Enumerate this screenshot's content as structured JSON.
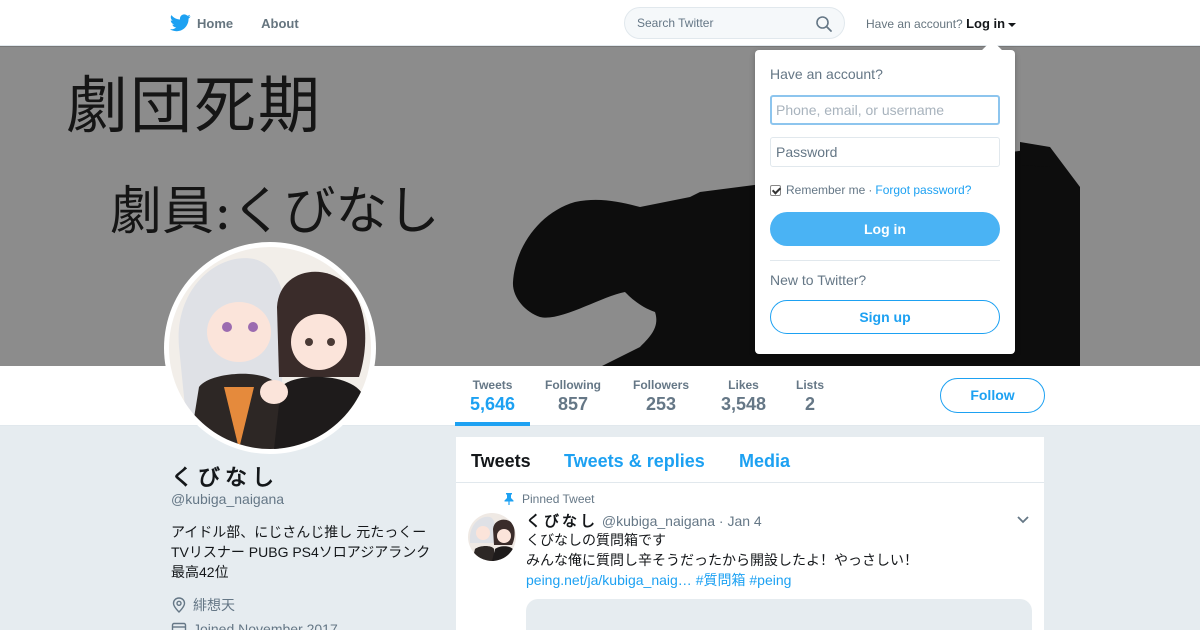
{
  "nav": {
    "home_label": "Home",
    "about_label": "About",
    "search_placeholder": "Search Twitter",
    "have_account": "Have an account?",
    "login_label": "Log in"
  },
  "banner": {
    "title": "劇団死期",
    "subtitle": "劇員:くびなし"
  },
  "stats": [
    {
      "label": "Tweets",
      "value": "5,646"
    },
    {
      "label": "Following",
      "value": "857"
    },
    {
      "label": "Followers",
      "value": "253"
    },
    {
      "label": "Likes",
      "value": "3,548"
    },
    {
      "label": "Lists",
      "value": "2"
    }
  ],
  "follow_label": "Follow",
  "profile": {
    "name": "くびなし",
    "handle": "@kubiga_naigana",
    "bio": "アイドル部、にじさんじ推し 元たっくーTVリスナー PUBG PS4ソロアジアランク最高42位",
    "location": "緋想天",
    "joined": "Joined November 2017"
  },
  "timeline": {
    "tabs": [
      "Tweets",
      "Tweets & replies",
      "Media"
    ],
    "pinned_label": "Pinned Tweet",
    "tweet": {
      "name": "くびなし",
      "handle": "@kubiga_naigana",
      "date": "· Jan 4",
      "line1": "くびなしの質問箱です",
      "line2": "みんな俺に質問し辛そうだったから開設したよ！やっさしい！",
      "link": "peing.net/ja/kubiga_naig…",
      "hashtag1": "#質問箱",
      "hashtag2": "#peing"
    }
  },
  "login_dropdown": {
    "heading": "Have an account?",
    "username_placeholder": "Phone, email, or username",
    "password_placeholder": "Password",
    "remember_me": "Remember me",
    "separator": "·",
    "forgot_password": "Forgot password?",
    "login_button": "Log in",
    "new_to_twitter": "New to Twitter?",
    "signup_button": "Sign up"
  },
  "colors": {
    "accent": "#1da1f2",
    "background": "#e6ecf0",
    "banner_gray": "#8c8c8c"
  }
}
